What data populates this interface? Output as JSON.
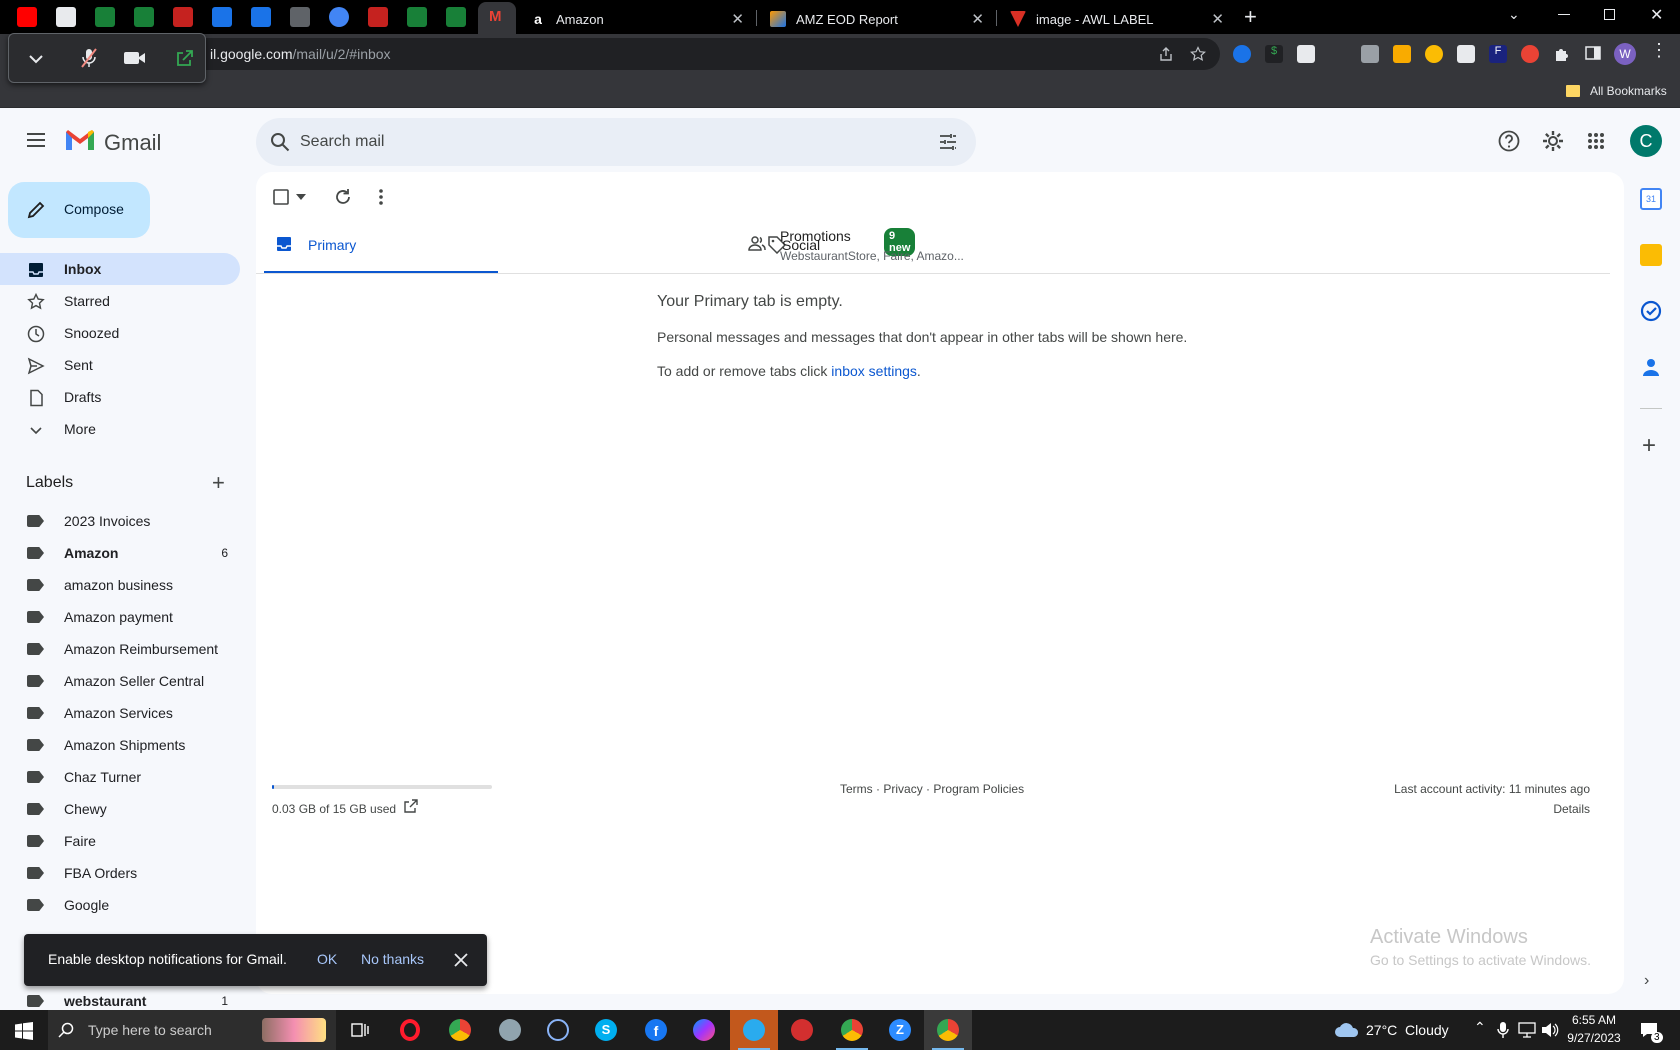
{
  "browser": {
    "tabs": [
      {
        "title": "Amazon",
        "color": "#ffffff"
      },
      {
        "title": "AMZ EOD Report",
        "color": "#ff9900"
      },
      {
        "title": "image - AWL LABEL",
        "color": "#d93025"
      }
    ],
    "url_prefix": "il.google.com",
    "url_path": "/mail/u/2/#inbox",
    "bookmarks_label": "All Bookmarks",
    "profile_initial": "W"
  },
  "gmail": {
    "logo_text": "Gmail",
    "search_placeholder": "Search mail",
    "account_initial": "C",
    "compose_label": "Compose",
    "nav": [
      {
        "label": "Inbox",
        "icon": "inbox-icon",
        "active": true
      },
      {
        "label": "Starred",
        "icon": "star-icon"
      },
      {
        "label": "Snoozed",
        "icon": "clock-icon"
      },
      {
        "label": "Sent",
        "icon": "send-icon"
      },
      {
        "label": "Drafts",
        "icon": "draft-icon"
      },
      {
        "label": "More",
        "icon": "chevron-down-icon"
      }
    ],
    "labels_heading": "Labels",
    "labels": [
      {
        "label": "2023 Invoices",
        "count": ""
      },
      {
        "label": "Amazon",
        "count": "6",
        "bold": true
      },
      {
        "label": "amazon business",
        "count": ""
      },
      {
        "label": "Amazon payment",
        "count": ""
      },
      {
        "label": "Amazon Reimbursement",
        "count": ""
      },
      {
        "label": "Amazon Seller Central",
        "count": ""
      },
      {
        "label": "Amazon Services",
        "count": ""
      },
      {
        "label": "Amazon Shipments",
        "count": ""
      },
      {
        "label": "Chaz Turner",
        "count": ""
      },
      {
        "label": "Chewy",
        "count": ""
      },
      {
        "label": "Faire",
        "count": ""
      },
      {
        "label": "FBA Orders",
        "count": ""
      },
      {
        "label": "Google",
        "count": ""
      },
      {
        "label": "webstaurant",
        "count": "1",
        "bold": true
      }
    ],
    "tabs": {
      "primary": "Primary",
      "promotions": "Promotions",
      "promotions_badge": "9 new",
      "promotions_senders": "WebstaurantStore, Faire, Amazo...",
      "social": "Social"
    },
    "empty": {
      "heading": "Your Primary tab is empty.",
      "line1": "Personal messages and messages that don't appear in other tabs will be shown here.",
      "line2_prefix": "To add or remove tabs click ",
      "line2_link": "inbox settings",
      "line2_suffix": "."
    },
    "footer": {
      "storage": "0.03 GB of 15 GB used",
      "storage_fraction": 0.002,
      "terms": "Terms",
      "privacy": "Privacy",
      "policies": "Program Policies",
      "sep": "·",
      "activity": "Last account activity: 11 minutes ago",
      "details": "Details"
    },
    "toast": {
      "message": "Enable desktop notifications for Gmail.",
      "ok": "OK",
      "no_thanks": "No thanks"
    },
    "watermark": {
      "title": "Activate Windows",
      "subtitle": "Go to Settings to activate Windows."
    }
  },
  "taskbar": {
    "search_placeholder": "Type here to search",
    "weather": "27°C  Cloudy",
    "time": "6:55 AM",
    "date": "9/27/2023",
    "notifications": "3"
  },
  "colors": {
    "accent_blue": "#0b57d0",
    "compose_bg": "#c2e7ff",
    "active_nav": "#d3e3fd",
    "badge_green": "#188038"
  }
}
